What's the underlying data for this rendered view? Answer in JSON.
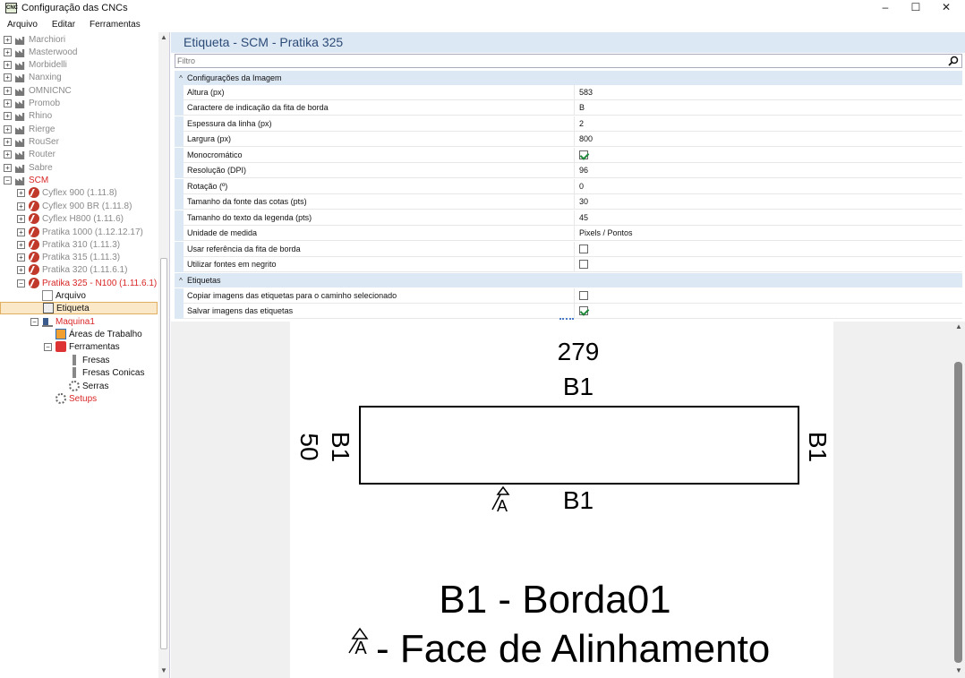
{
  "window": {
    "title": "Configuração das CNCs",
    "app_icon_text": "CNC",
    "minimize": "–",
    "maximize": "☐",
    "close": "✕"
  },
  "menu": [
    "Arquivo",
    "Editar",
    "Ferramentas"
  ],
  "tree": {
    "brands": [
      "Marchiori",
      "Masterwood",
      "Morbidelli",
      "Nanxing",
      "OMNICNC",
      "Promob",
      "Rhino",
      "Rierge",
      "RouSer",
      "Router",
      "Sabre"
    ],
    "scm": "SCM",
    "scm_models": [
      "Cyflex 900 (1.11.8)",
      "Cyflex 900 BR (1.11.8)",
      "Cyflex H800 (1.11.6)",
      "Pratika 1000 (1.12.12.17)",
      "Pratika 310 (1.11.3)",
      "Pratika 315 (1.11.3)",
      "Pratika 320 (1.11.6.1)"
    ],
    "active_model": "Pratika 325 - N100 (1.11.6.1)",
    "arquivo": "Arquivo",
    "etiqueta": "Etiqueta",
    "maquina": "Maquina1",
    "areas": "Áreas de Trabalho",
    "ferramentas": "Ferramentas",
    "fresas": "Fresas",
    "fresas_conicas": "Fresas Conicas",
    "serras": "Serras",
    "setups": "Setups"
  },
  "panel": {
    "title": "Etiqueta - SCM - Pratika 325",
    "filter_placeholder": "Filtro"
  },
  "groups": {
    "image": "Configurações da Imagem",
    "labels": "Etiquetas"
  },
  "image_props": [
    {
      "name": "Altura (px)",
      "value": "583"
    },
    {
      "name": "Caractere de indicação da fita de borda",
      "value": "B"
    },
    {
      "name": "Espessura da linha (px)",
      "value": "2"
    },
    {
      "name": "Largura (px)",
      "value": "800"
    },
    {
      "name": "Monocromático",
      "checked": true
    },
    {
      "name": "Resolução (DPI)",
      "value": "96"
    },
    {
      "name": "Rotação (º)",
      "value": "0"
    },
    {
      "name": "Tamanho da fonte das cotas (pts)",
      "value": "30"
    },
    {
      "name": "Tamanho do texto da legenda (pts)",
      "value": "45"
    },
    {
      "name": "Unidade de medida",
      "value": "Pixels / Pontos"
    },
    {
      "name": "Usar referência da fita de borda",
      "checked": false
    },
    {
      "name": "Utilizar fontes em negrito",
      "checked": false
    }
  ],
  "label_props": [
    {
      "name": "Copiar imagens das etiquetas para o caminho selecionado",
      "checked": false
    },
    {
      "name": "Salvar imagens das etiquetas",
      "checked": true
    }
  ],
  "preview": {
    "width_dim": "279",
    "height_dim": "50",
    "edge_top": "B1",
    "edge_bottom": "B1",
    "edge_left": "B1",
    "edge_right": "B1",
    "align_mark": "A",
    "legend_edge": "B1 - Borda01",
    "legend_align": "- Face de Alinhamento"
  }
}
